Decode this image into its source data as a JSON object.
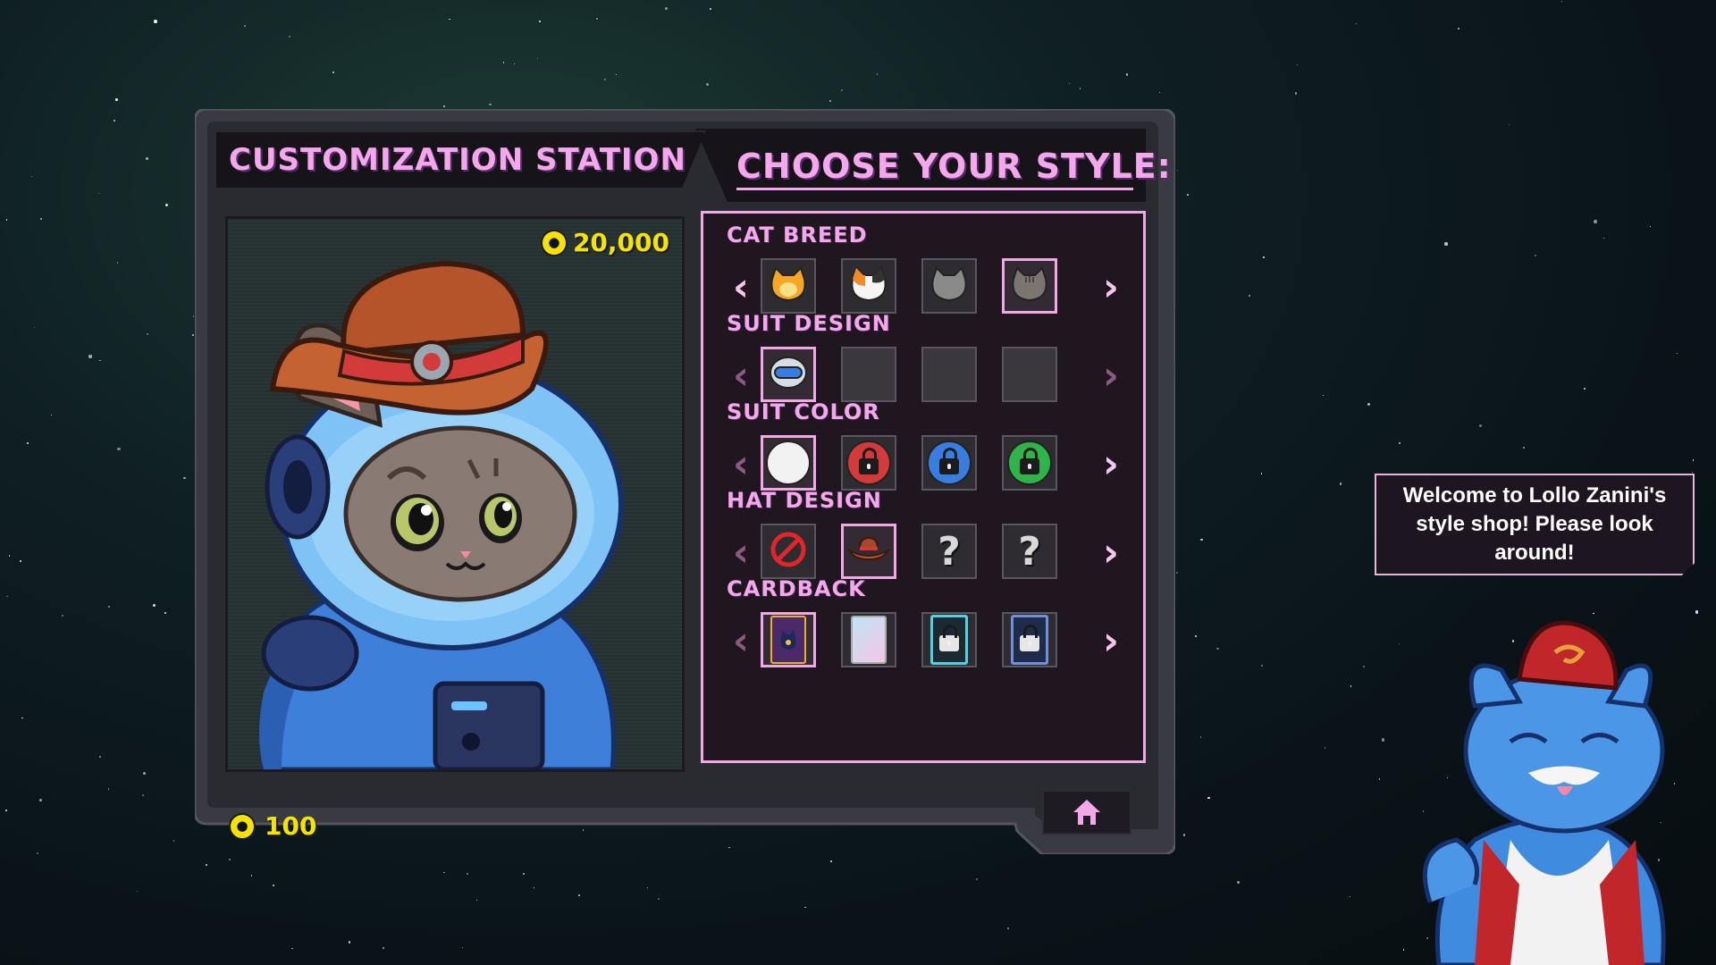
{
  "header": {
    "title": "CUSTOMIZATION STATION",
    "choose_title": "CHOOSE YOUR STYLE:"
  },
  "currency": {
    "premium_amount": "20,000",
    "basic_amount": "100",
    "icon": "paw-coin-icon"
  },
  "sections": [
    {
      "label": "CAT BREED",
      "slots": [
        "orange-cat-icon",
        "calico-cat-icon",
        "gray-cat-icon",
        "tabby-cat-icon"
      ],
      "selected": 3,
      "left_enabled": true,
      "right_enabled": true
    },
    {
      "label": "SUIT DESIGN",
      "slots": [
        "helmet-icon",
        "empty",
        "empty",
        "empty"
      ],
      "selected": 0,
      "left_enabled": false,
      "right_enabled": false
    },
    {
      "label": "SUIT COLOR",
      "slots": [
        "white-swatch",
        "red-lock",
        "blue-lock",
        "green-lock"
      ],
      "selected": 0,
      "left_enabled": false,
      "right_enabled": true
    },
    {
      "label": "HAT DESIGN",
      "slots": [
        "no-hat-icon",
        "cowboy-hat-icon",
        "question-mark",
        "question-mark"
      ],
      "selected": 1,
      "left_enabled": false,
      "right_enabled": true
    },
    {
      "label": "CARDBACK",
      "slots": [
        "cat-cardback",
        "pastel-cardback",
        "teal-locked-cardback",
        "blue-locked-cardback"
      ],
      "selected": 0,
      "left_enabled": false,
      "right_enabled": true
    }
  ],
  "colors": {
    "accent_pink": "#f4a8ec",
    "coin_yellow": "#f6e400",
    "suit_red": "#d33a3a",
    "suit_blue": "#3a7de0",
    "suit_green": "#2fb44a"
  },
  "speech": {
    "text": "Welcome to Lollo Zanini's style shop! Please look around!"
  },
  "nav": {
    "home_icon": "home-icon"
  }
}
